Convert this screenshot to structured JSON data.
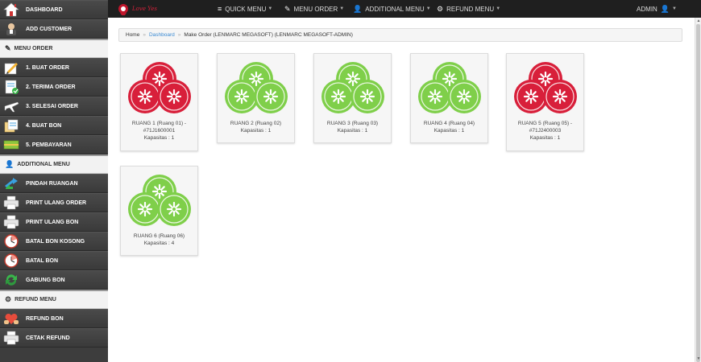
{
  "sidebar": {
    "items": [
      {
        "label": "DASHBOARD",
        "icon": "home-icon",
        "type": "item"
      },
      {
        "label": "ADD CUSTOMER",
        "icon": "user-icon",
        "type": "item"
      },
      {
        "label": "MENU ORDER",
        "icon": "edit-icon",
        "type": "header"
      },
      {
        "label": "1. BUAT ORDER",
        "icon": "pencil-icon",
        "type": "item"
      },
      {
        "label": "2. TERIMA ORDER",
        "icon": "checklist-icon",
        "type": "item"
      },
      {
        "label": "3. SELESAI ORDER",
        "icon": "airplane-icon",
        "type": "item"
      },
      {
        "label": "4. BUAT BON",
        "icon": "documents-icon",
        "type": "item"
      },
      {
        "label": "5. PEMBAYARAN",
        "icon": "money-icon",
        "type": "item"
      },
      {
        "label": "ADDITIONAL MENU",
        "icon": "user-plus-icon",
        "type": "header"
      },
      {
        "label": "PINDAH RUANGAN",
        "icon": "transfer-arrows-icon",
        "type": "item"
      },
      {
        "label": "PRINT ULANG ORDER",
        "icon": "printer-icon",
        "type": "item"
      },
      {
        "label": "PRINT ULANG BON",
        "icon": "printer-icon",
        "type": "item"
      },
      {
        "label": "BATAL BON KOSONG",
        "icon": "clock-icon",
        "type": "item"
      },
      {
        "label": "BATAL BON",
        "icon": "clock-icon",
        "type": "item"
      },
      {
        "label": "GABUNG BON",
        "icon": "refresh-icon",
        "type": "item"
      },
      {
        "label": "REFUND MENU",
        "icon": "refund-icon",
        "type": "header"
      },
      {
        "label": "REFUND BON",
        "icon": "heart-hands-icon",
        "type": "item"
      },
      {
        "label": "CETAK REFUND",
        "icon": "printer-icon",
        "type": "item"
      }
    ]
  },
  "topbar": {
    "logo_text": "Love Yes",
    "menus": [
      {
        "label": "QUICK MENU",
        "icon": "hamburger-icon"
      },
      {
        "label": "MENU ORDER",
        "icon": "edit-icon"
      },
      {
        "label": "ADDITIONAL MENU",
        "icon": "user-plus-icon"
      },
      {
        "label": "REFUND MENU",
        "icon": "refund-icon"
      }
    ],
    "admin_label": "ADMIN"
  },
  "breadcrumb": {
    "home": "Home",
    "dashboard": "Dashboard",
    "current": "Make Order (LENMARC MEGASOFT) (LENMARC MEGASOFT-ADMIN)"
  },
  "rooms": [
    {
      "name": "RUANG 1 (Ruang 01) - #71J1600001",
      "capacity": "Kapasitas : 1",
      "status": "occupied"
    },
    {
      "name": "RUANG 2 (Ruang 02)",
      "capacity": "Kapasitas : 1",
      "status": "available"
    },
    {
      "name": "RUANG 3 (Ruang 03)",
      "capacity": "Kapasitas : 1",
      "status": "available"
    },
    {
      "name": "RUANG 4 (Ruang 04)",
      "capacity": "Kapasitas : 1",
      "status": "available"
    },
    {
      "name": "RUANG 5 (Ruang 05) - #71J2400003",
      "capacity": "Kapasitas : 1",
      "status": "occupied"
    },
    {
      "name": "RUANG 6 (Ruang 06)",
      "capacity": "Kapasitas : 4",
      "status": "available"
    }
  ],
  "colors": {
    "occupied": "#d81f3a",
    "available": "#7fcf4a",
    "topbar_bg": "#1f1f1f",
    "sidebar_bg": "#3d3d3d",
    "link": "#3a8ad3"
  }
}
